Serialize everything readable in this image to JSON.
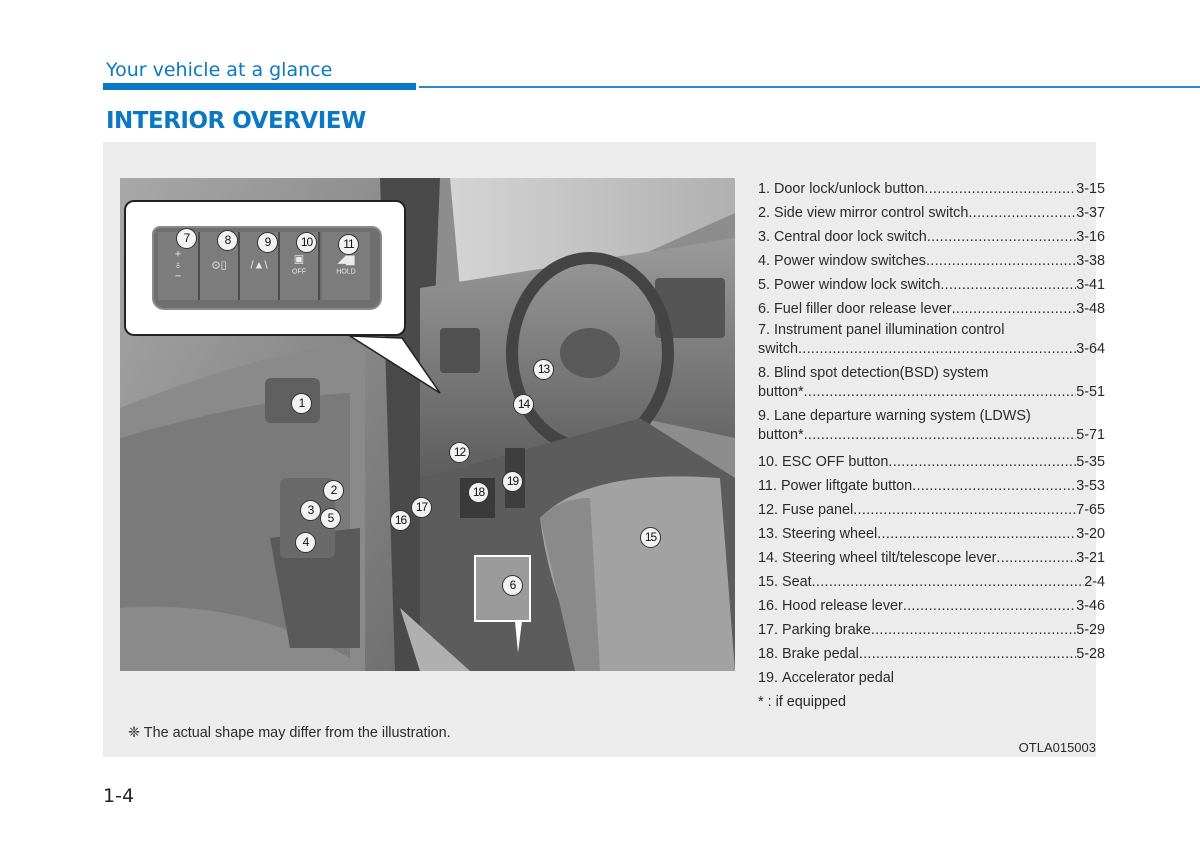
{
  "header": {
    "section": "Your vehicle at a glance",
    "title": "INTERIOR OVERVIEW",
    "accent_color": "#0a78c2"
  },
  "illustration": {
    "callout_badges": [
      "7",
      "8",
      "9",
      "10",
      "11"
    ],
    "callout_icons": [
      "illumination-control-icon",
      "bsd-icon",
      "ldws-icon",
      "esc-off-icon",
      "liftgate-icon"
    ],
    "callout_button_labels": {
      "esc": "OFF",
      "liftgate": "HOLD",
      "plus": "+",
      "minus": "−"
    },
    "badges": [
      "1",
      "2",
      "3",
      "4",
      "5",
      "6",
      "12",
      "13",
      "14",
      "15",
      "16",
      "17",
      "18",
      "19"
    ]
  },
  "items": [
    {
      "num": "1.",
      "label": "Door lock/unlock button ",
      "page": "3-15"
    },
    {
      "num": "2.",
      "label": "Side view mirror control switch ",
      "page": "3-37"
    },
    {
      "num": "3.",
      "label": "Central door lock switch ",
      "page": "3-16"
    },
    {
      "num": "4.",
      "label": "Power window switches ",
      "page": "3-38"
    },
    {
      "num": "5.",
      "label": "Power window lock switch",
      "page": "3-41"
    },
    {
      "num": "6.",
      "label": "Fuel filler door release lever ",
      "page": "3-48"
    },
    {
      "num": "7.",
      "label": "Instrument panel illumination control",
      "cont": "switch ",
      "page": "3-64"
    },
    {
      "num": "8.",
      "label": "Blind spot detection(BSD) system",
      "cont": "button*",
      "page": "5-51"
    },
    {
      "num": "9.",
      "label": "Lane departure warning system (LDWS)",
      "cont": "button*",
      "page": "5-71"
    },
    {
      "num": "10.",
      "label": "ESC OFF button ",
      "page": "5-35"
    },
    {
      "num": "11.",
      "label": "Power liftgate button ",
      "page": "3-53"
    },
    {
      "num": "12.",
      "label": "Fuse panel ",
      "page": "7-65"
    },
    {
      "num": "13.",
      "label": "Steering wheel ",
      "page": "3-20"
    },
    {
      "num": "14.",
      "label": "Steering wheel tilt/telescope lever ",
      "page": "3-21"
    },
    {
      "num": "15.",
      "label": "Seat",
      "page": "2-4"
    },
    {
      "num": "16.",
      "label": "Hood release lever ",
      "page": "3-46"
    },
    {
      "num": "17.",
      "label": "Parking brake ",
      "page": "5-29"
    },
    {
      "num": "18.",
      "label": "Brake pedal",
      "page": "5-28"
    },
    {
      "num": "19.",
      "label": "Accelerator pedal",
      "page": ""
    }
  ],
  "footnote_equipped": "* : if equipped",
  "note": "❈ The actual shape may differ from the illustration.",
  "image_code": "OTLA015003",
  "page_number": "1-4"
}
